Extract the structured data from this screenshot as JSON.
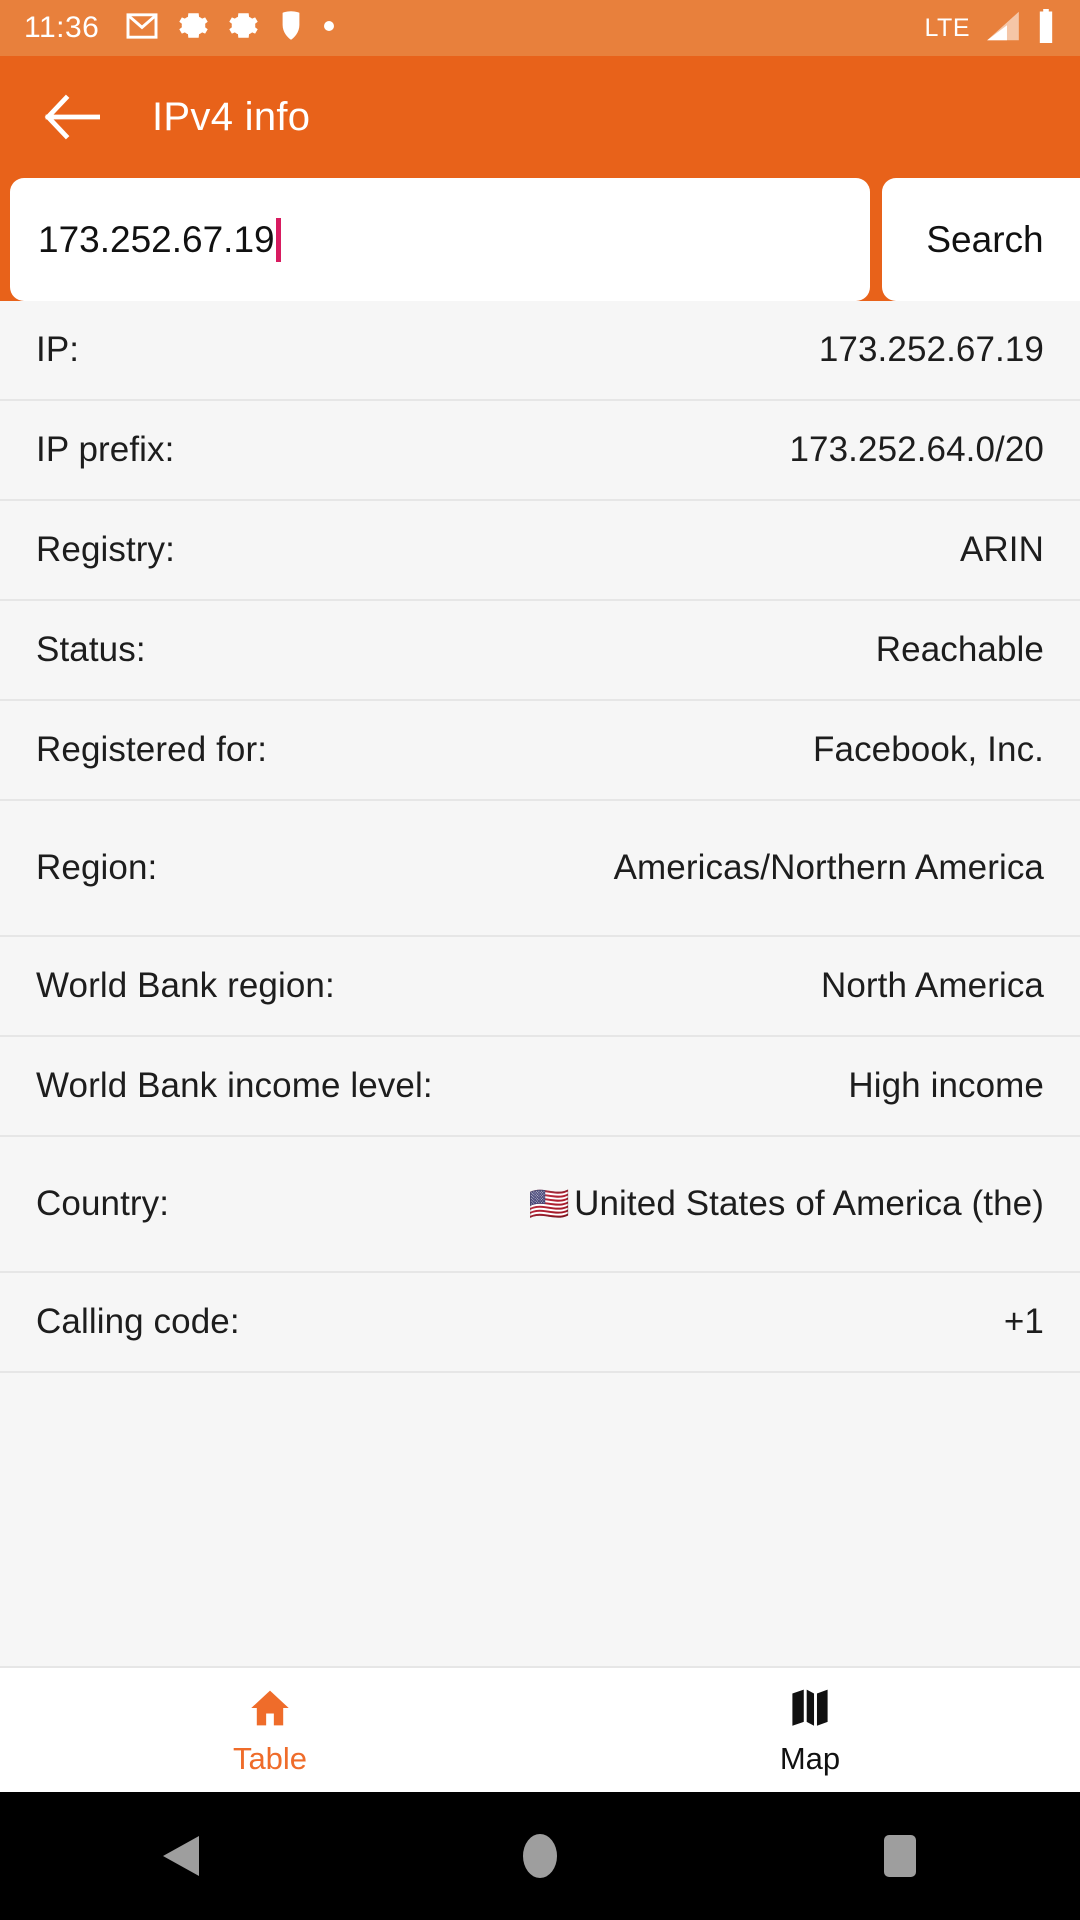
{
  "status_bar": {
    "time": "11:36",
    "left_icons": [
      "gmail-icon",
      "gear-icon",
      "gear-icon",
      "shield-icon",
      "dot-icon"
    ],
    "network_label": "LTE",
    "right_icons": [
      "signal-icon",
      "battery-icon"
    ],
    "background_color": "#e8803c",
    "foreground_color": "#ffffff"
  },
  "app_bar": {
    "back_icon": "back-arrow-icon",
    "title": "IPv4 info",
    "background_color": "#e8621a",
    "title_color": "#ffffff"
  },
  "search": {
    "value": "173.252.67.19",
    "placeholder": "",
    "caret_color": "#d81b60",
    "button_label": "Search"
  },
  "table": {
    "rows": [
      {
        "label": "IP:",
        "value": "173.252.67.19",
        "tall": false,
        "flag": ""
      },
      {
        "label": "IP prefix:",
        "value": "173.252.64.0/20",
        "tall": false,
        "flag": ""
      },
      {
        "label": "Registry:",
        "value": "ARIN",
        "tall": false,
        "flag": ""
      },
      {
        "label": "Status:",
        "value": "Reachable",
        "tall": false,
        "flag": ""
      },
      {
        "label": "Registered for:",
        "value": "Facebook, Inc.",
        "tall": false,
        "flag": ""
      },
      {
        "label": "Region:",
        "value": "Americas/Northern America",
        "tall": true,
        "flag": ""
      },
      {
        "label": "World Bank region:",
        "value": "North America",
        "tall": false,
        "flag": ""
      },
      {
        "label": "World Bank income level:",
        "value": "High income",
        "tall": false,
        "flag": ""
      },
      {
        "label": "Country:",
        "value": "United States of America (the)",
        "tall": true,
        "flag": "🇺🇸"
      },
      {
        "label": "Calling code:",
        "value": "+1",
        "tall": false,
        "flag": ""
      }
    ]
  },
  "tab_bar": {
    "active_color": "#ef6c2a",
    "inactive_color": "#111111",
    "tabs": [
      {
        "label": "Table",
        "icon": "home-icon",
        "active": true
      },
      {
        "label": "Map",
        "icon": "map-icon",
        "active": false
      }
    ]
  },
  "nav_bar": {
    "buttons": [
      "back-triangle-icon",
      "home-circle-icon",
      "recents-square-icon"
    ],
    "background_color": "#000000",
    "icon_color": "#9e9e9e"
  }
}
